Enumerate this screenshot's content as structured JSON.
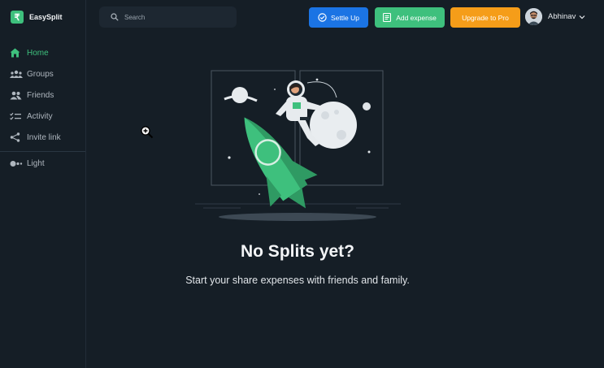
{
  "brand": {
    "logo_glyph": "₹",
    "name": "EasySplit",
    "color": "#3ec07d"
  },
  "sidebar": {
    "items": [
      {
        "label": "Home",
        "icon": "home-icon",
        "active": true
      },
      {
        "label": "Groups",
        "icon": "groups-icon"
      },
      {
        "label": "Friends",
        "icon": "friends-icon"
      },
      {
        "label": "Activity",
        "icon": "activity-icon"
      },
      {
        "label": "Invite link",
        "icon": "share-icon"
      }
    ],
    "theme_toggle": {
      "label": "Light",
      "icon": "theme-toggle-icon"
    }
  },
  "header": {
    "search": {
      "placeholder": "Search",
      "value": ""
    },
    "settle_up_label": "Settle Up",
    "add_expense_label": "Add expense",
    "upgrade_label": "Upgrade to Pro",
    "user_name": "Abhinav"
  },
  "colors": {
    "background": "#151e26",
    "settle_up": "#1b74e4",
    "add_expense": "#3ec07d",
    "upgrade": "#f59d19"
  },
  "empty_state": {
    "title": "No Splits yet?",
    "subtitle": "Start your share expenses with friends and family.",
    "illustration": "astronaut-riding-rocket"
  }
}
